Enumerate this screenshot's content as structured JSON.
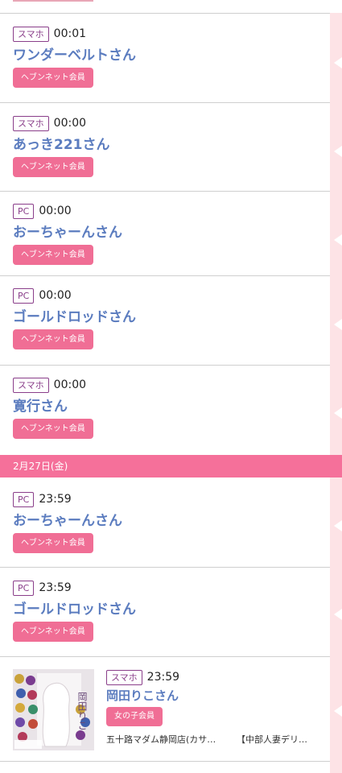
{
  "entries": [
    {
      "device": "スマホ",
      "time": "00:01",
      "name": "ワンダーベルトさん",
      "badge": "ヘブンネット会員"
    },
    {
      "device": "スマホ",
      "time": "00:00",
      "name": "あっき221さん",
      "badge": "ヘブンネット会員"
    },
    {
      "device": "PC",
      "time": "00:00",
      "name": "おーちゃーんさん",
      "badge": "ヘブンネット会員"
    },
    {
      "device": "PC",
      "time": "00:00",
      "name": "ゴールドロッドさん",
      "badge": "ヘブンネット会員"
    },
    {
      "device": "スマホ",
      "time": "00:00",
      "name": "寛行さん",
      "badge": "ヘブンネット会員"
    }
  ],
  "date_bar": "2月27日(金)",
  "entries2": [
    {
      "device": "PC",
      "time": "23:59",
      "name": "おーちゃーんさん",
      "badge": "ヘブンネット会員"
    },
    {
      "device": "PC",
      "time": "23:59",
      "name": "ゴールドロッドさん",
      "badge": "ヘブンネット会員"
    }
  ],
  "photo_entry": {
    "device": "スマホ",
    "time": "23:59",
    "name": "岡田りこさん",
    "badge": "女の子会員",
    "shop_name": "五十路マダム静岡店(カサ…",
    "shop_group": "【中部人妻デリ…",
    "thumb_text": "岡田りこ"
  },
  "colors": {
    "accent_pink": "#f06e95",
    "date_bar": "#f5709a",
    "name_blue": "#5b7cbf",
    "device_purple": "#8a3e8a",
    "rail_pink": "#fde3e6"
  }
}
